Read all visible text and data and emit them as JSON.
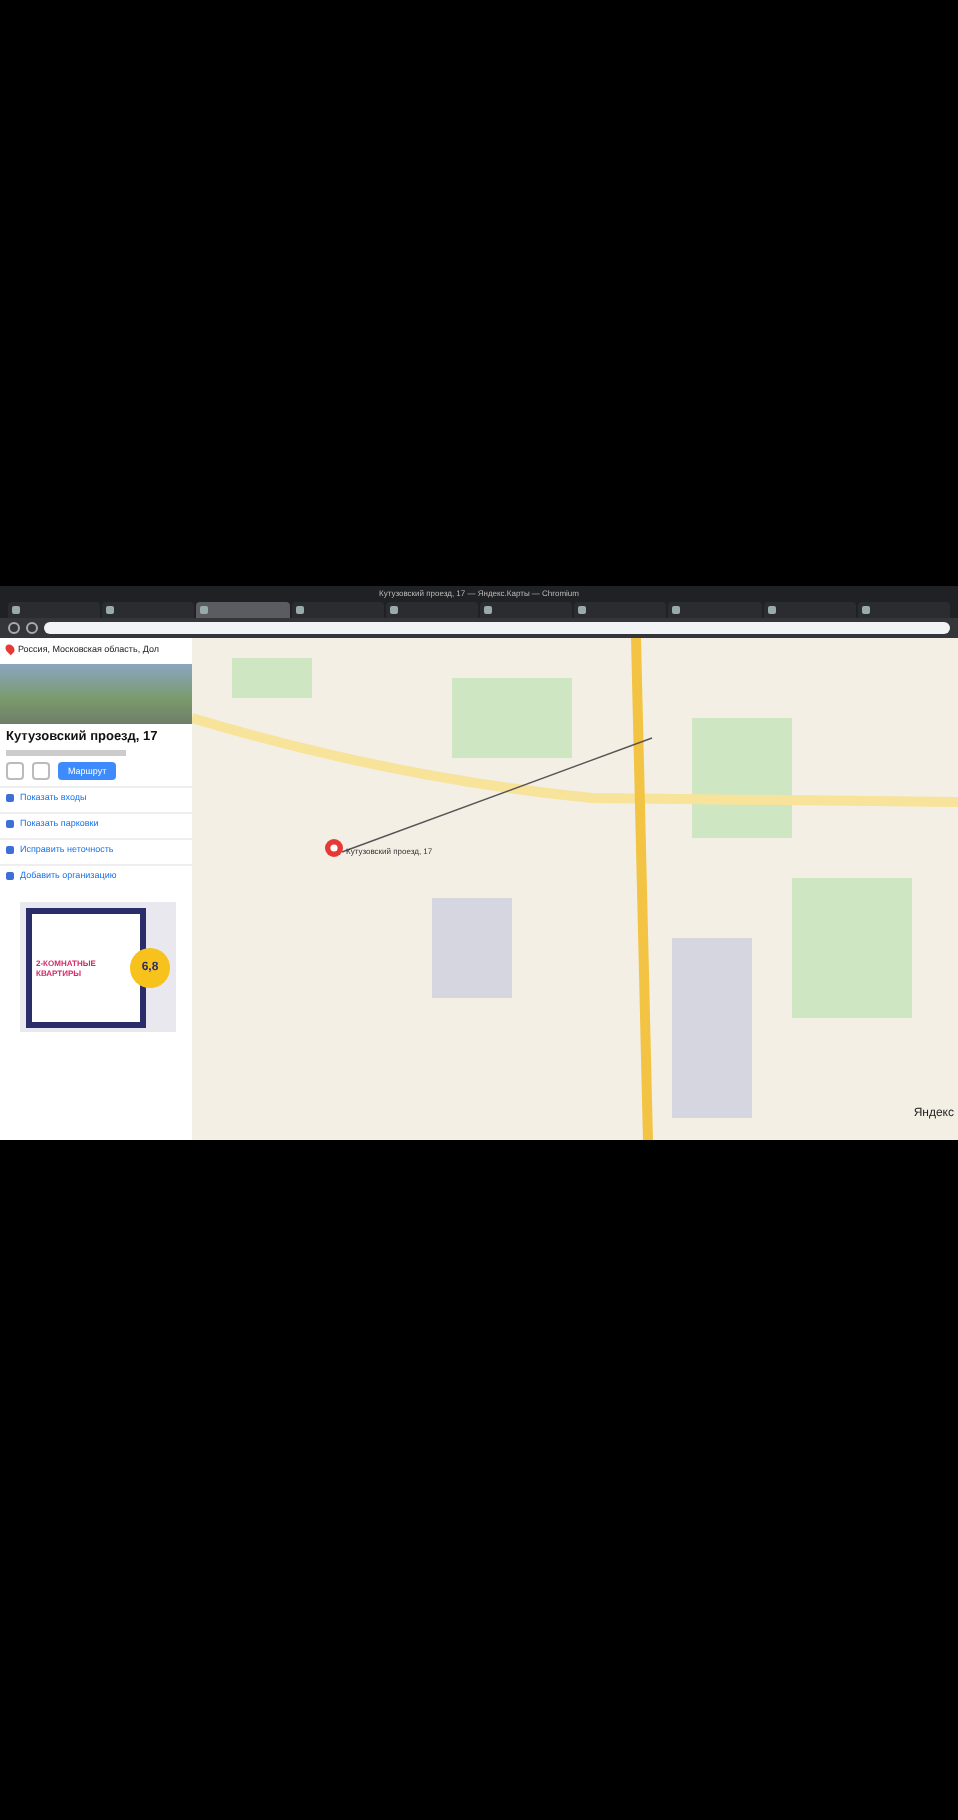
{
  "window": {
    "title": "Кутузовский проезд, 17 — Яндекс.Карты — Chromium"
  },
  "tabs": [
    {
      "selected": false
    },
    {
      "selected": false
    },
    {
      "selected": true
    },
    {
      "selected": false
    },
    {
      "selected": false
    },
    {
      "selected": false
    },
    {
      "selected": false
    },
    {
      "selected": false
    },
    {
      "selected": false
    },
    {
      "selected": false
    }
  ],
  "search": {
    "value": "Россия, Московская область, Дол"
  },
  "place": {
    "title": "Кутузовский проезд, 17",
    "route_button": "Маршрут",
    "actions": [
      "Показать входы",
      "Показать парковки",
      "Исправить неточность",
      "Добавить организацию"
    ]
  },
  "ad": {
    "price": "6,8",
    "headline": "2-КОМНАТНЫЕ КВАРТИРЫ"
  },
  "map": {
    "marker_label": "Кутузовский проезд, 17",
    "logo": "Яндекс"
  }
}
